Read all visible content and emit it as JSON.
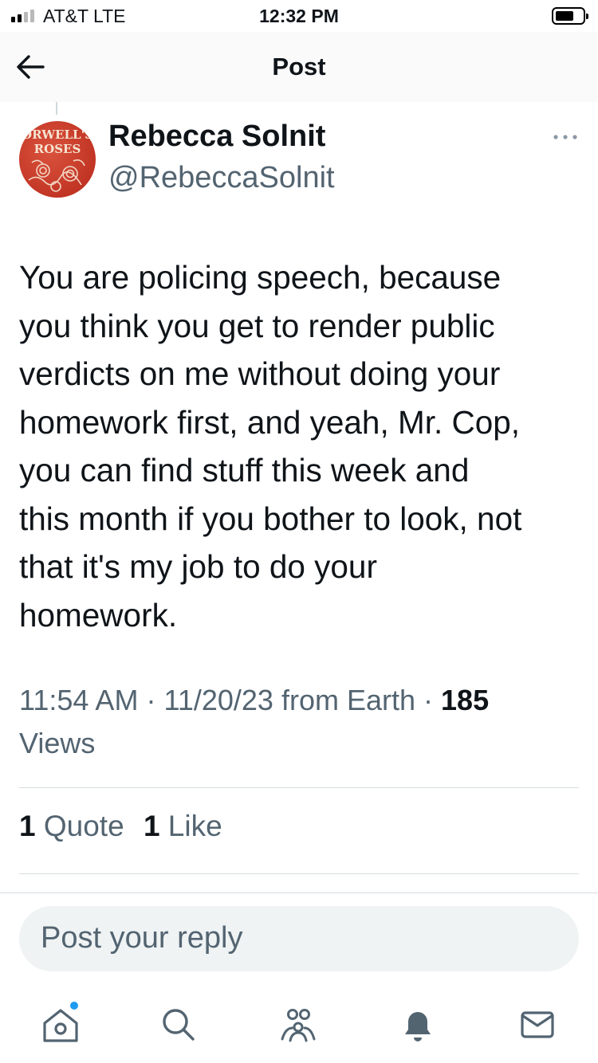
{
  "status_bar": {
    "carrier": "AT&T  LTE",
    "time": "12:32 PM"
  },
  "header": {
    "title": "Post"
  },
  "author": {
    "name": "Rebecca Solnit",
    "handle": "@RebeccaSolnit",
    "avatar_text_line1": "ORWELL'S",
    "avatar_text_line2": "ROSES"
  },
  "tweet": {
    "text": "You are policing speech, because\nyou think you get to render public\nverdicts on me without doing your\nhomework first, and yeah, Mr. Cop,\nyou can find stuff this week and\nthis month if you bother to look, not\nthat it's my job to do your\nhomework.",
    "time": "11:54 AM",
    "date": "11/20/23",
    "source": "from Earth",
    "views_count": "185",
    "views_label": "Views",
    "separator": "·"
  },
  "engagement": {
    "quotes_count": "1",
    "quotes_label": "Quote",
    "likes_count": "1",
    "likes_label": "Like"
  },
  "reply": {
    "placeholder": "Post your reply"
  },
  "tab_bar": {
    "items": [
      "home-icon",
      "search-icon",
      "communities-icon",
      "notifications-icon",
      "messages-icon"
    ],
    "has_new_home": true
  },
  "colors": {
    "accent": "#1d9bf0",
    "secondary_text": "#536471",
    "avatar_red": "#c7372a"
  }
}
